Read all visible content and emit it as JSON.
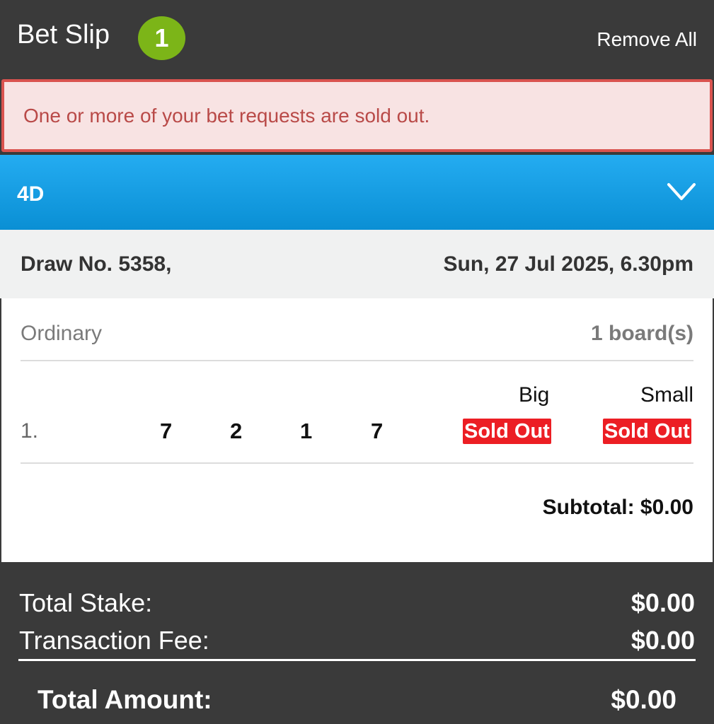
{
  "header": {
    "title": "Bet Slip",
    "count": "1",
    "remove_all": "Remove All"
  },
  "alert": {
    "message": "One or more of your bet requests are sold out."
  },
  "game": {
    "name": "4D",
    "toggle_icon": "chevron-down-icon"
  },
  "draw": {
    "number": "Draw No. 5358,",
    "datetime": "Sun, 27 Jul 2025, 6.30pm"
  },
  "bet": {
    "type": "Ordinary",
    "boards": "1 board(s)",
    "columns": {
      "big": "Big",
      "small": "Small"
    },
    "lines": [
      {
        "index": "1.",
        "digits": [
          "7",
          "2",
          "1",
          "7"
        ],
        "big": "Sold Out",
        "small": "Sold Out"
      }
    ],
    "subtotal": "Subtotal: $0.00"
  },
  "summary": {
    "total_stake_label": "Total Stake:",
    "total_stake_value": "$0.00",
    "fee_label": "Transaction Fee:",
    "fee_value": "$0.00",
    "total_label": "Total Amount:",
    "total_value": "$0.00"
  },
  "colors": {
    "header_bg": "#3a3a3a",
    "badge": "#7cb518",
    "alert_border": "#d9534f",
    "alert_text": "#b94a48",
    "game_bar": "#0a8fd4",
    "sold_out": "#ec1e24"
  }
}
